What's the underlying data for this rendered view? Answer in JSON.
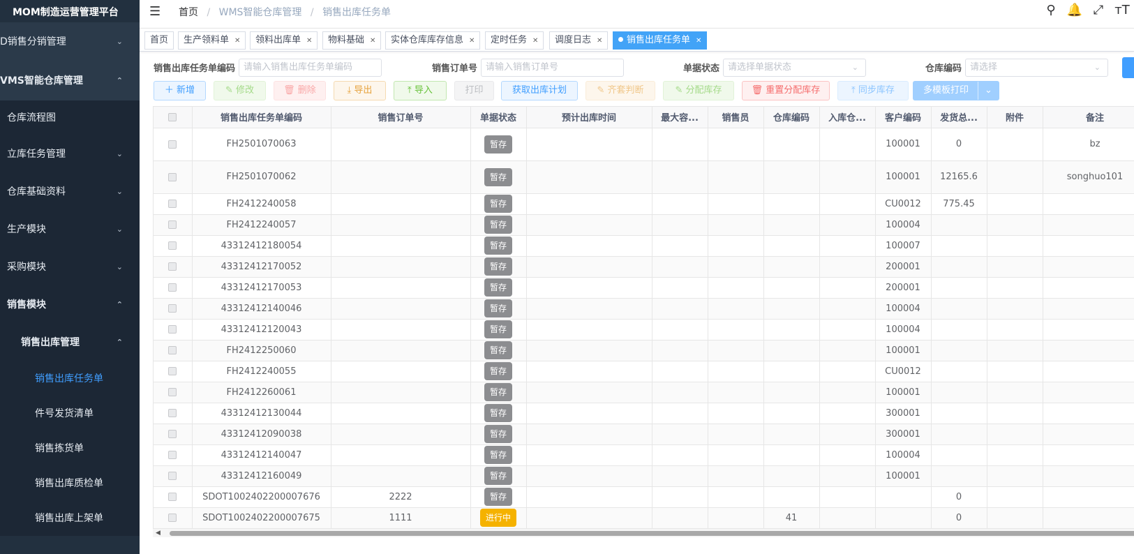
{
  "app": {
    "title": "MOM制造运营管理平台"
  },
  "sidebar": {
    "items": [
      {
        "label": "D销售分销管理",
        "chevron": "v"
      },
      {
        "label": "VMS智能仓库管理",
        "chevron": "^"
      },
      {
        "label": "仓库流程图",
        "chevron": ""
      },
      {
        "label": "立库任务管理",
        "chevron": "v"
      },
      {
        "label": "仓库基础资料",
        "chevron": "v"
      },
      {
        "label": "生产模块",
        "chevron": "v"
      },
      {
        "label": "采购模块",
        "chevron": "v"
      },
      {
        "label": "销售模块",
        "chevron": "^"
      },
      {
        "label": "销售出库管理",
        "chevron": "^"
      },
      {
        "label": "销售出库任务单",
        "chevron": ""
      },
      {
        "label": "件号发货清单",
        "chevron": ""
      },
      {
        "label": "销售拣货单",
        "chevron": ""
      },
      {
        "label": "销售出库质检单",
        "chevron": ""
      },
      {
        "label": "销售出库上架单",
        "chevron": ""
      }
    ]
  },
  "header": {
    "breadcrumb": [
      "首页",
      "WMS智能仓库管理",
      "销售出库任务单"
    ],
    "sep": "/",
    "icons": [
      "search-icon",
      "bell-icon",
      "fullscreen-icon",
      "font-size-icon"
    ]
  },
  "tags": [
    {
      "label": "首页",
      "closable": false
    },
    {
      "label": "生产领料单",
      "closable": true
    },
    {
      "label": "领料出库单",
      "closable": true
    },
    {
      "label": "物料基础",
      "closable": true
    },
    {
      "label": "实体仓库库存信息",
      "closable": true
    },
    {
      "label": "定时任务",
      "closable": true
    },
    {
      "label": "调度日志",
      "closable": true
    },
    {
      "label": "销售出库任务单",
      "closable": true,
      "active": true
    }
  ],
  "search": {
    "task_code_label": "销售出库任务单编码",
    "task_code_placeholder": "请输入销售出库任务单编码",
    "order_no_label": "销售订单号",
    "order_no_placeholder": "请输入销售订单号",
    "status_label": "单据状态",
    "status_placeholder": "请选择单据状态",
    "warehouse_label": "仓库编码",
    "warehouse_placeholder": "请选择"
  },
  "toolbar": {
    "add": "＋ 新增",
    "edit": "✎ 修改",
    "delete": "🗑 删除",
    "export": "⤓ 导出",
    "import": "⤒ 导入",
    "print": "打印",
    "fetch_plan": "获取出库计划",
    "kit_check": "✎ 齐套判断",
    "allocate": "✎ 分配库存",
    "reset_allocate": "🗑 重置分配库存",
    "sync_stock": "⤒ 同步库存",
    "template_print": "多模板打印"
  },
  "table": {
    "headers": [
      "销售出库任务单编码",
      "销售订单号",
      "单据状态",
      "预计出库时间",
      "最大容...",
      "销售员",
      "仓库编码",
      "入库仓...",
      "客户编码",
      "发货总...",
      "附件",
      "备注"
    ],
    "rows": [
      {
        "code": "FH2501070063",
        "order": "",
        "status": "暂存",
        "time": "",
        "max": "",
        "sales": "",
        "wh": "",
        "inwh": "",
        "cust": "100001",
        "total": "0",
        "att": "",
        "remark": "bz",
        "tall": true
      },
      {
        "code": "FH2501070062",
        "order": "",
        "status": "暂存",
        "time": "",
        "max": "",
        "sales": "",
        "wh": "",
        "inwh": "",
        "cust": "100001",
        "total": "12165.6",
        "att": "",
        "remark": "songhuo101",
        "tall": true
      },
      {
        "code": "FH2412240058",
        "order": "",
        "status": "暂存",
        "time": "",
        "max": "",
        "sales": "",
        "wh": "",
        "inwh": "",
        "cust": "CU0012",
        "total": "775.45",
        "att": "",
        "remark": ""
      },
      {
        "code": "FH2412240057",
        "order": "",
        "status": "暂存",
        "time": "",
        "max": "",
        "sales": "",
        "wh": "",
        "inwh": "",
        "cust": "100004",
        "total": "",
        "att": "",
        "remark": ""
      },
      {
        "code": "43312412180054",
        "order": "",
        "status": "暂存",
        "time": "",
        "max": "",
        "sales": "",
        "wh": "",
        "inwh": "",
        "cust": "100007",
        "total": "",
        "att": "",
        "remark": ""
      },
      {
        "code": "43312412170052",
        "order": "",
        "status": "暂存",
        "time": "",
        "max": "",
        "sales": "",
        "wh": "",
        "inwh": "",
        "cust": "200001",
        "total": "",
        "att": "",
        "remark": ""
      },
      {
        "code": "43312412170053",
        "order": "",
        "status": "暂存",
        "time": "",
        "max": "",
        "sales": "",
        "wh": "",
        "inwh": "",
        "cust": "200001",
        "total": "",
        "att": "",
        "remark": ""
      },
      {
        "code": "43312412140046",
        "order": "",
        "status": "暂存",
        "time": "",
        "max": "",
        "sales": "",
        "wh": "",
        "inwh": "",
        "cust": "100004",
        "total": "",
        "att": "",
        "remark": ""
      },
      {
        "code": "43312412120043",
        "order": "",
        "status": "暂存",
        "time": "",
        "max": "",
        "sales": "",
        "wh": "",
        "inwh": "",
        "cust": "100004",
        "total": "",
        "att": "",
        "remark": ""
      },
      {
        "code": "FH2412250060",
        "order": "",
        "status": "暂存",
        "time": "",
        "max": "",
        "sales": "",
        "wh": "",
        "inwh": "",
        "cust": "100001",
        "total": "",
        "att": "",
        "remark": ""
      },
      {
        "code": "FH2412240055",
        "order": "",
        "status": "暂存",
        "time": "",
        "max": "",
        "sales": "",
        "wh": "",
        "inwh": "",
        "cust": "CU0012",
        "total": "",
        "att": "",
        "remark": ""
      },
      {
        "code": "FH2412260061",
        "order": "",
        "status": "暂存",
        "time": "",
        "max": "",
        "sales": "",
        "wh": "",
        "inwh": "",
        "cust": "100001",
        "total": "",
        "att": "",
        "remark": ""
      },
      {
        "code": "43312412130044",
        "order": "",
        "status": "暂存",
        "time": "",
        "max": "",
        "sales": "",
        "wh": "",
        "inwh": "",
        "cust": "300001",
        "total": "",
        "att": "",
        "remark": ""
      },
      {
        "code": "43312412090038",
        "order": "",
        "status": "暂存",
        "time": "",
        "max": "",
        "sales": "",
        "wh": "",
        "inwh": "",
        "cust": "300001",
        "total": "",
        "att": "",
        "remark": ""
      },
      {
        "code": "43312412140047",
        "order": "",
        "status": "暂存",
        "time": "",
        "max": "",
        "sales": "",
        "wh": "",
        "inwh": "",
        "cust": "100004",
        "total": "",
        "att": "",
        "remark": ""
      },
      {
        "code": "43312412160049",
        "order": "",
        "status": "暂存",
        "time": "",
        "max": "",
        "sales": "",
        "wh": "",
        "inwh": "",
        "cust": "100001",
        "total": "",
        "att": "",
        "remark": ""
      },
      {
        "code": "SDOT1002402200007676",
        "order": "2222",
        "status": "暂存",
        "time": "",
        "max": "",
        "sales": "",
        "wh": "",
        "inwh": "",
        "cust": "",
        "total": "0",
        "att": "",
        "remark": ""
      },
      {
        "code": "SDOT1002402200007675",
        "order": "1111",
        "status": "进行中",
        "time": "",
        "max": "",
        "sales": "",
        "wh": "41",
        "inwh": "",
        "cust": "",
        "total": "0",
        "att": "",
        "remark": ""
      }
    ]
  },
  "colors": {
    "sidebar_bg": "#22303f",
    "accent": "#409eff",
    "status_draft": "#8c8d90",
    "status_running": "#f5b200"
  }
}
